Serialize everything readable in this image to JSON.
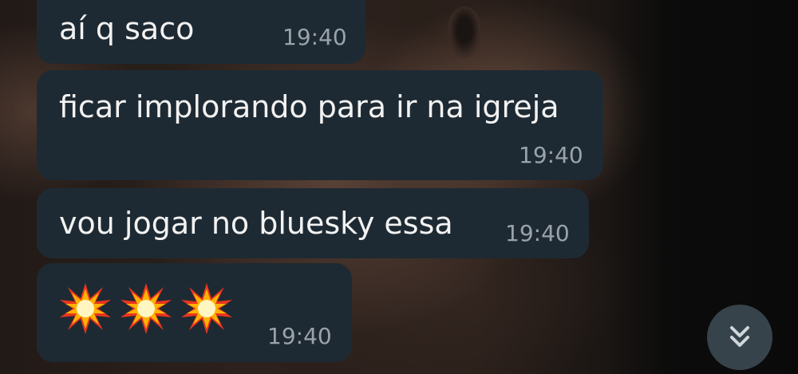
{
  "messages": [
    {
      "text": "aí q saco",
      "time": "19:40"
    },
    {
      "text": "ficar implorando para ir na igreja",
      "time": "19:40"
    },
    {
      "text": "vou jogar no bluesky essa",
      "time": "19:40"
    },
    {
      "text": "💥💥💥",
      "time": "19:40"
    }
  ],
  "scroll_button": {
    "icon": "double-chevron-down-icon"
  },
  "colors": {
    "bubble": "#1e2a33",
    "text": "#f2f2f2",
    "time": "#9aa3aa",
    "button": "#37434b"
  }
}
